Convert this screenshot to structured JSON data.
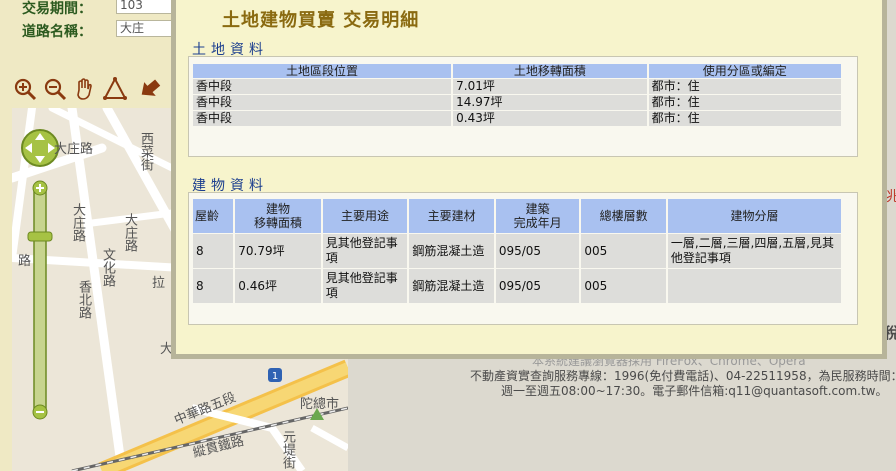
{
  "left_panel": {
    "fields": [
      {
        "label": "交易期間：",
        "value": "103"
      },
      {
        "label": "道路名稱：",
        "value": "大庄"
      }
    ],
    "tools": [
      "zoom-in-icon",
      "zoom-out-icon",
      "hand-icon",
      "polygon-icon",
      "arrow-icon"
    ]
  },
  "map": {
    "labels": [
      "大庄路",
      "西菜街",
      "大庄路",
      "大庄路",
      "香北路",
      "文化路",
      "拉",
      "路",
      "大",
      "中華路五段",
      "縱貫鐵路",
      "元堤街",
      "陀總市"
    ],
    "road_badge": "1"
  },
  "background_text": {
    "line1": "本系統建議瀏覽器採用 FireFox、Chrome、Opera",
    "line2": "不動產資實查詢服務專線：1996(免付費電話)、04-22511958，為民服務時間：",
    "line3": "週一至週五08:00~17:30。電子郵件信箱:q11@quantasoft.com.tw。",
    "edge_chars": [
      "稅",
      "兆"
    ]
  },
  "modal": {
    "title": "土地建物買賣 交易明細",
    "land": {
      "section_title": "土地資料",
      "headers": [
        "土地區段位置",
        "土地移轉面積",
        "使用分區或編定"
      ],
      "rows": [
        [
          "香中段",
          "7.01坪",
          "都市：住"
        ],
        [
          "香中段",
          "14.97坪",
          "都市：住"
        ],
        [
          "香中段",
          "0.43坪",
          "都市：住"
        ]
      ]
    },
    "building": {
      "section_title": "建物資料",
      "headers": [
        "屋齡",
        "建物\n移轉面積",
        "主要用途",
        "主要建材",
        "建築\n完成年月",
        "總樓層數",
        "建物分層"
      ],
      "rows": [
        [
          "8",
          "70.79坪",
          "見其他登記事項",
          "鋼筋混凝土造",
          "095/05",
          "005",
          "一層,二層,三層,四層,五層,見其他登記事項"
        ],
        [
          "8",
          "0.46坪",
          "見其他登記事項",
          "鋼筋混凝土造",
          "095/05",
          "005",
          ""
        ]
      ]
    }
  }
}
